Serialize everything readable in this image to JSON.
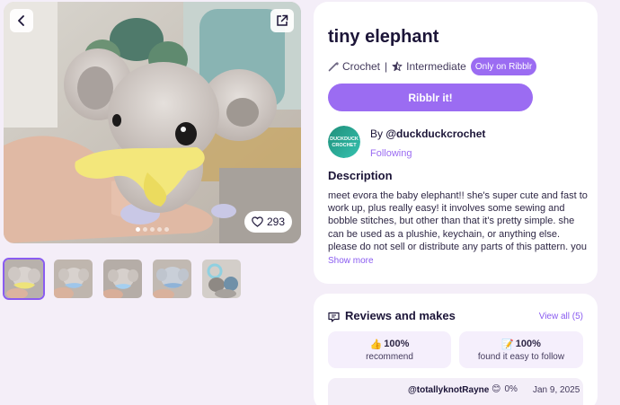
{
  "pattern": {
    "title": "tiny elephant",
    "craft": "Crochet",
    "separator": "|",
    "skill_level": "Intermediate",
    "exclusive_badge": "Only on Ribblr",
    "primary_action": "Ribblr it!",
    "likes": "293"
  },
  "gallery": {
    "slide_count": 5,
    "active_slide": 1,
    "thumbnails": 5,
    "active_thumbnail": 1
  },
  "creator": {
    "by_label": "By",
    "handle": "@duckduckcrochet",
    "avatar_text": "DUCKDUCK CROCHET",
    "follow_label": "Following"
  },
  "description": {
    "heading": "Description",
    "text": "meet evora the baby elephant!! she's super cute and fast to work up, plus really easy! it involves some sewing and bobble stitches, but other than that it's pretty simple. she can be used as a plushie, keychain, or anything else. please do not sell or distribute any parts of this pattern. you may...",
    "show_more": "Show more"
  },
  "reviews": {
    "heading": "Reviews and makes",
    "view_all": "View all (5)",
    "stats": [
      {
        "emoji": "👍",
        "value": "100%",
        "label": "recommend"
      },
      {
        "emoji": "📝",
        "value": "100%",
        "label": "found it easy to follow"
      }
    ],
    "first_review": {
      "user": "@totallyknotRayne",
      "emoji": "😊",
      "percent": "0%",
      "date": "Jan 9, 2025"
    }
  },
  "colors": {
    "accent": "#9b6cf2",
    "page_background": "#f4eef8",
    "card_background": "#ffffff",
    "text": "#1c1538"
  },
  "icons": [
    "back-arrow-icon",
    "share-external-icon",
    "heart-icon",
    "crochet-hook-icon",
    "star-skill-icon",
    "reviews-bubble-icon"
  ]
}
